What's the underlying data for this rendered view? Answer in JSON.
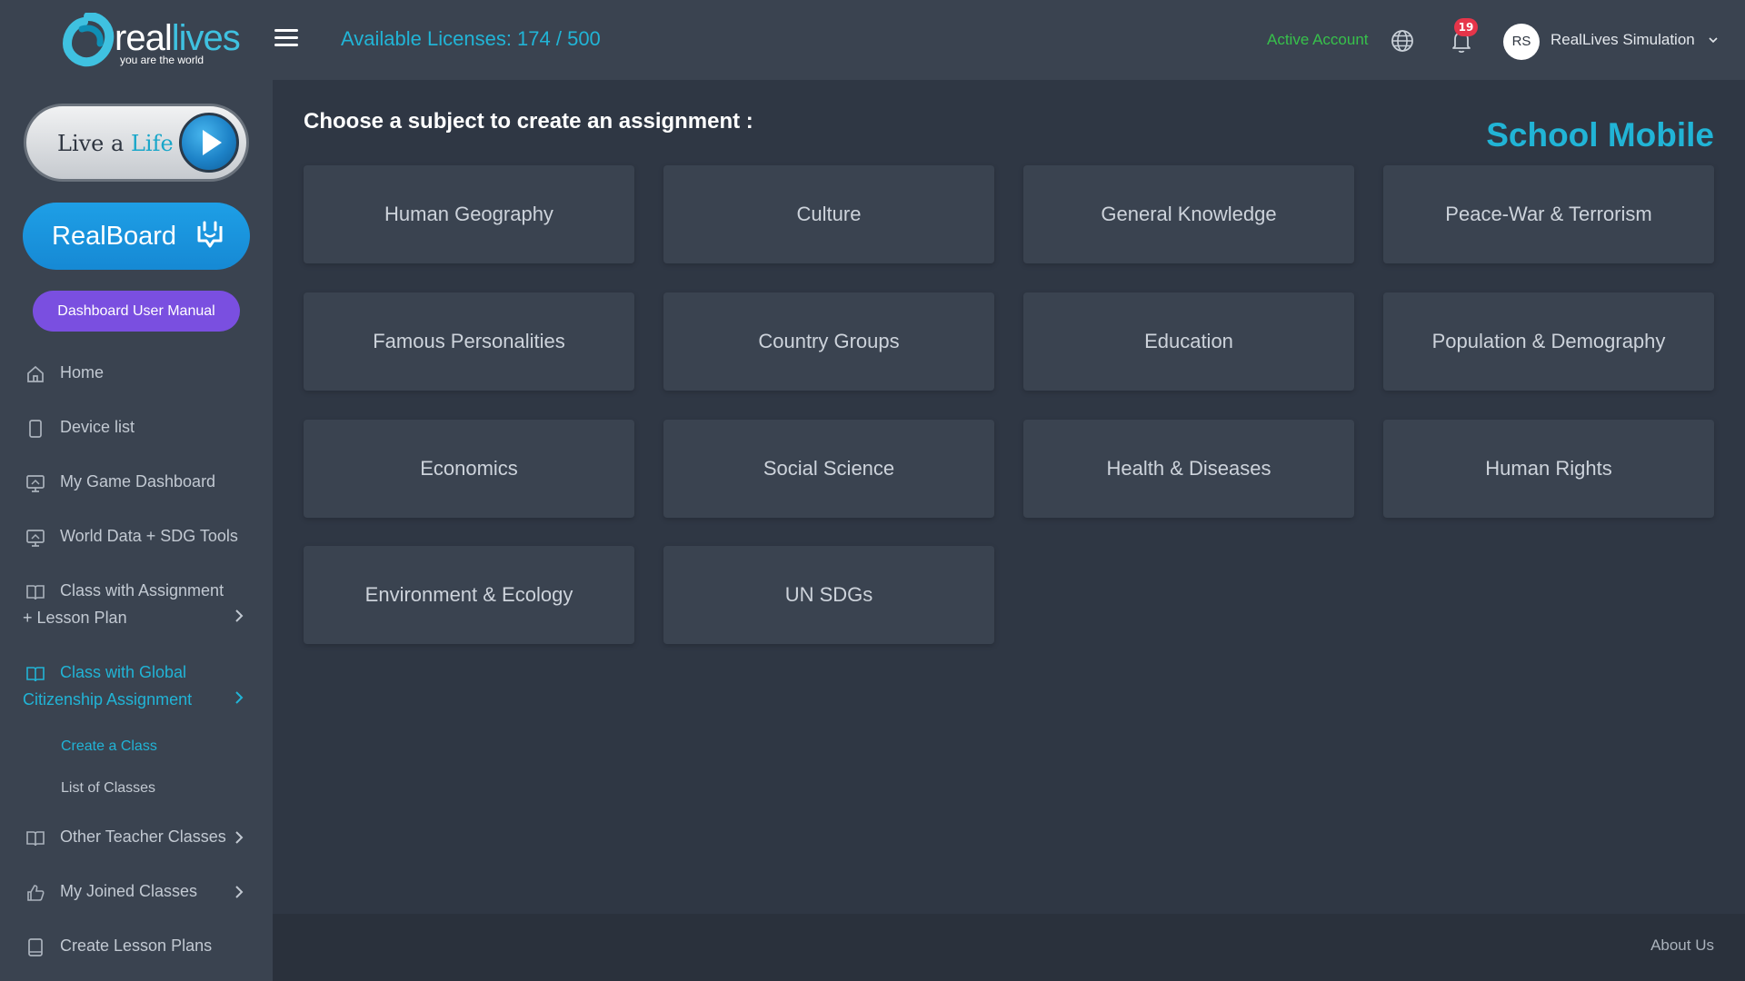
{
  "brand": {
    "logo_main": "real",
    "logo_accent": "lives",
    "tagline": "you are the world"
  },
  "sidebar": {
    "live_a_life": {
      "prefix": "Live a ",
      "accent": "Life"
    },
    "realboard_label": "RealBoard",
    "manual_label": "Dashboard User Manual",
    "items": [
      {
        "label": "Home",
        "icon": "home-icon"
      },
      {
        "label": "Device list",
        "icon": "device-icon"
      },
      {
        "label": "My Game Dashboard",
        "icon": "monitor-icon"
      },
      {
        "label": "World Data + SDG Tools",
        "icon": "monitor-icon"
      },
      {
        "line1": "Class with Assignment",
        "line2": "+ Lesson Plan",
        "icon": "book-icon"
      },
      {
        "line1": "Class with Global",
        "line2": "Citizenship Assignment",
        "icon": "book-icon",
        "active": true
      },
      {
        "label": "Other Teacher Classes",
        "icon": "book-icon"
      },
      {
        "label": "My Joined Classes",
        "icon": "thumbs-up-icon"
      },
      {
        "label": "Create Lesson Plans",
        "icon": "tablet-icon"
      }
    ],
    "sub_items": [
      {
        "label": "Create a Class",
        "active": true
      },
      {
        "label": "List of Classes",
        "active": false
      }
    ]
  },
  "header": {
    "licenses": "Available Licenses: 174 / 500",
    "active_account": "Active Account",
    "notification_count": "19",
    "avatar_initials": "RS",
    "user_name": "RealLives Simulation"
  },
  "main": {
    "title": "Choose a subject to create an assignment :",
    "platform": "School Mobile",
    "subjects": [
      "Human Geography",
      "Culture",
      "General Knowledge",
      "Peace-War & Terrorism",
      "Famous Personalities",
      "Country Groups",
      "Education",
      "Population & Demography",
      "Economics",
      "Social Science",
      "Health & Diseases",
      "Human Rights",
      "Environment & Ecology",
      "UN SDGs"
    ]
  },
  "footer": {
    "about": "About Us"
  },
  "colors": {
    "accent": "#21b4d6",
    "active_green": "#37c14b",
    "badge_red": "#e6354a",
    "manual_purple": "#7a4fe0",
    "realboard_blue": "#1e9fe6"
  }
}
